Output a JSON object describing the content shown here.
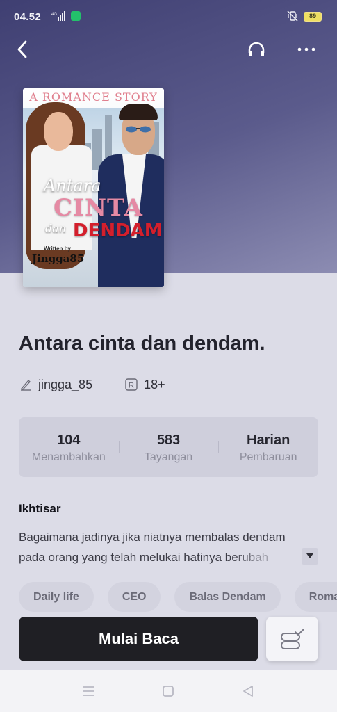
{
  "status_bar": {
    "time": "04.52",
    "network": "4G",
    "battery": "89"
  },
  "book": {
    "cover": {
      "tagline": "A ROMANCE STORY",
      "title_line1": "Antara",
      "title_line2": "CINTA",
      "title_line3": "dan",
      "title_line4": "DENDAM",
      "written_by": "Written by",
      "author": "Jingga85"
    },
    "title": "Antara cinta dan dendam.",
    "author": "jingga_85",
    "rating": "18+",
    "stats": [
      {
        "value": "104",
        "label": "Menambahkan"
      },
      {
        "value": "583",
        "label": "Tayangan"
      },
      {
        "value": "Harian",
        "label": "Pembaruan"
      }
    ],
    "synopsis_title": "Ikhtisar",
    "synopsis": "Bagaimana jadinya jika niatnya membalas dendam pada orang yang telah melukai hatinya berubah",
    "tags": [
      "Daily life",
      "CEO",
      "Balas Dendam",
      "Romance"
    ]
  },
  "actions": {
    "start_reading": "Mulai Baca"
  },
  "icons": {
    "back": "chevron-left-icon",
    "audio": "headphones-icon",
    "more": "more-horizontal-icon",
    "author": "pen-icon",
    "rating": "r-rating-icon",
    "expand": "caret-down-icon",
    "chapters": "chapter-list-icon"
  },
  "colors": {
    "hero_top": "#3f3f72",
    "hero_bottom": "#8c8cb2",
    "page_bg": "#dcdce7",
    "primary_button": "#1f1f24"
  }
}
